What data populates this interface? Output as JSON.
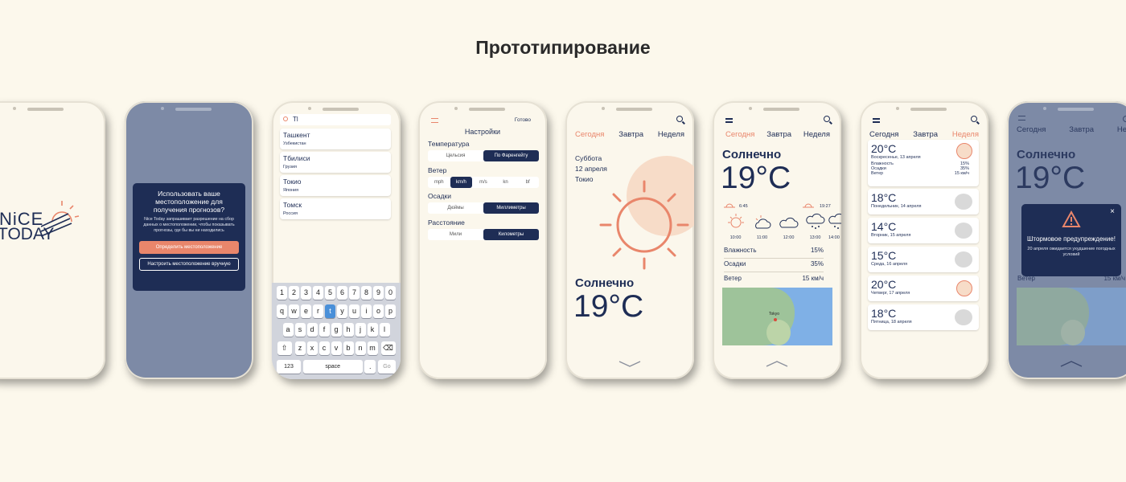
{
  "title": "Прототипирование",
  "colors": {
    "navy": "#1e2d55",
    "accent": "#e9866b",
    "background": "#fcf8ec"
  },
  "phone1": {
    "logo_top": "NiCE",
    "logo_bottom": "TODAY"
  },
  "phone2": {
    "question": "Использовать ваше местоположение для получения прогнозов?",
    "body": "Nice Today запрашивает разрешение на сбор данных о местоположении, чтобы показывать прогнозы, где бы вы ни находились",
    "btn_detect": "Определить местоположение",
    "btn_manual": "Настроить местоположение вручную"
  },
  "phone3": {
    "search_value": "Tl",
    "cities": [
      {
        "name": "Ташкент",
        "country": "Узбекистан"
      },
      {
        "name": "Тбилиси",
        "country": "Грузия"
      },
      {
        "name": "Токио",
        "country": "Япония"
      },
      {
        "name": "Томск",
        "country": "Россия"
      }
    ],
    "keys_row1": [
      "1",
      "2",
      "3",
      "4",
      "5",
      "6",
      "7",
      "8",
      "9",
      "0"
    ],
    "keys_row2": [
      "q",
      "w",
      "e",
      "r",
      "t",
      "y",
      "u",
      "i",
      "o",
      "p"
    ],
    "keys_row3": [
      "a",
      "s",
      "d",
      "f",
      "g",
      "h",
      "j",
      "k",
      "l"
    ],
    "keys_row4": [
      "z",
      "x",
      "c",
      "v",
      "b",
      "n",
      "m"
    ],
    "key_123": "123",
    "key_space": "space",
    "key_dot": ".",
    "key_go": "Go"
  },
  "phone4": {
    "done": "Готово",
    "title": "Настройки",
    "temperature": "Температура",
    "temp_opts": [
      "Цельсия",
      "По Фаренгейту"
    ],
    "wind": "Ветер",
    "wind_opts": [
      "mph",
      "km/h",
      "m/s",
      "kn",
      "bf"
    ],
    "precip": "Осадки",
    "precip_opts": [
      "Дюймы",
      "Миллиметры"
    ],
    "distance": "Расстояние",
    "distance_opts": [
      "Мили",
      "Километры"
    ]
  },
  "tabs": {
    "today": "Сегодня",
    "tomorrow": "Завтра",
    "week": "Неделя"
  },
  "phone5": {
    "date_day": "Суббота",
    "date": "12 апреля",
    "city": "Токио",
    "condition": "Солнечно",
    "temp": "19°C"
  },
  "phone6": {
    "condition": "Солнечно",
    "temp": "19°C",
    "sunrise": "6:45",
    "sunset": "19:27",
    "hours": [
      "10:00",
      "11:00",
      "12:00",
      "13:00",
      "14:00"
    ],
    "humidity_label": "Влажность",
    "humidity": "15%",
    "precip_label": "Осадки",
    "precip": "35%",
    "wind_label": "Ветер",
    "wind": "15 км/ч",
    "map_label": "Tokyo"
  },
  "phone7": {
    "days": [
      {
        "temp": "20°C",
        "date": "Воскресенье, 13 апреля"
      },
      {
        "temp": "18°C",
        "date": "Понедельник, 14 апреля"
      },
      {
        "temp": "14°C",
        "date": "Вторник, 15 апреля"
      },
      {
        "temp": "15°C",
        "date": "Среда, 16 апреля"
      },
      {
        "temp": "20°C",
        "date": "Четверг, 17 апреля"
      },
      {
        "temp": "18°C",
        "date": "Пятница, 18 апреля"
      }
    ],
    "detail": [
      {
        "label": "Влажность",
        "value": "15%"
      },
      {
        "label": "Осадки",
        "value": "35%"
      },
      {
        "label": "Ветер",
        "value": "15 км/ч"
      }
    ]
  },
  "phone8": {
    "condition": "Солнечно",
    "temp": "19°C",
    "alert_title": "Штормовое предупреждение!",
    "alert_body": "20 апреля ожидается ухудшение погодных условий",
    "wind_label": "Ветер",
    "wind": "15 км/ч"
  }
}
